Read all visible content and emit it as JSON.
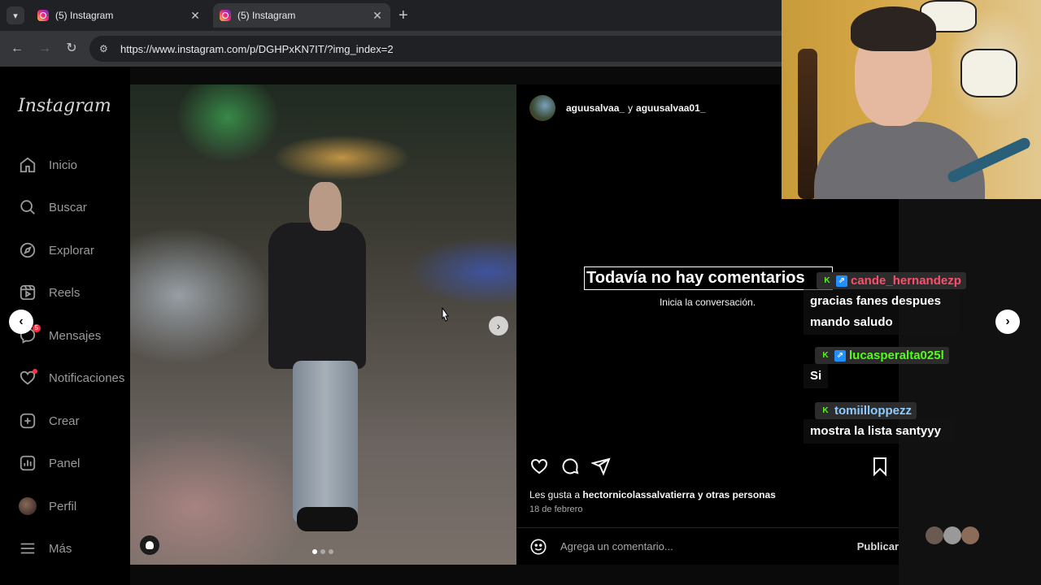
{
  "browser": {
    "tabs": [
      {
        "title": "(5) Instagram",
        "active": false
      },
      {
        "title": "(5) Instagram",
        "active": true
      }
    ],
    "url": "https://www.instagram.com/p/DGHPxKN7IT/?img_index=2"
  },
  "sidebar": {
    "logo": "Instagram",
    "items": [
      {
        "label": "Inicio",
        "icon": "home-icon"
      },
      {
        "label": "Buscar",
        "icon": "search-icon"
      },
      {
        "label": "Explorar",
        "icon": "compass-icon"
      },
      {
        "label": "Reels",
        "icon": "reels-icon"
      },
      {
        "label": "Mensajes",
        "icon": "messenger-icon",
        "badge": "5"
      },
      {
        "label": "Notificaciones",
        "icon": "heart-icon"
      },
      {
        "label": "Crear",
        "icon": "plus-square-icon"
      },
      {
        "label": "Panel",
        "icon": "chart-icon"
      },
      {
        "label": "Perfil",
        "icon": "avatar"
      },
      {
        "label": "Más",
        "icon": "menu-icon"
      }
    ]
  },
  "post": {
    "author_a": "aguusalvaa_",
    "connector": "y",
    "author_b": "aguusalvaa01_",
    "carousel_index": 2,
    "carousel_count": 3,
    "empty_title": "Todavía no hay comentarios",
    "empty_subtitle": "Inicia la conversación.",
    "likes_prefix": "Les gusta a",
    "likes_user": "hectornicolassalvatierra",
    "likes_suffix": "y otras personas",
    "date": "18 de febrero",
    "comment_placeholder": "Agrega un comentario...",
    "publish_label": "Publicar"
  },
  "chat": [
    {
      "user": "cande_hernandezp",
      "color": "#ff4d6d",
      "badges": [
        "kick",
        "prime"
      ],
      "text": "gracias fanes despues mando saludo"
    },
    {
      "user": "lucasperalta025l",
      "color": "#53fc18",
      "badges": [
        "kick",
        "prime"
      ],
      "text": "Si"
    },
    {
      "user": "tomiilloppezz",
      "color": "#8ecbff",
      "badges": [
        "kick"
      ],
      "text": "mostra la lista santyyy"
    }
  ]
}
